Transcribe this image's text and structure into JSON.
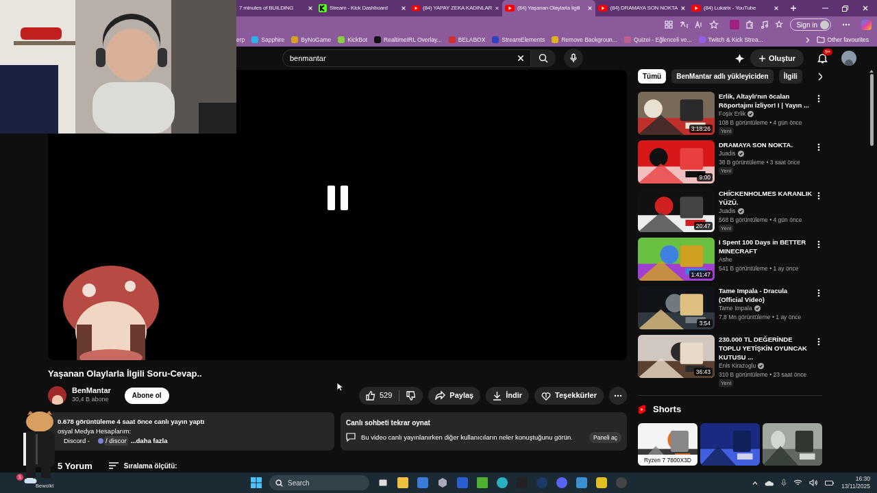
{
  "browser": {
    "tabs": [
      {
        "title": "7 minutes of BUILDING",
        "selected": false
      },
      {
        "title": "Stream - Kick Dashboard",
        "selected": false
      },
      {
        "title": "(84) YAPAY ZEKA KADINLAR",
        "selected": false
      },
      {
        "title": "(84) Yaşanan Olaylarla İlgili",
        "selected": true
      },
      {
        "title": "(84) DRAMAYA SON NOKTA",
        "selected": false
      },
      {
        "title": "(84) Lukarix - YouTube",
        "selected": false
      }
    ],
    "sign_in": "Sign in",
    "bookmarks": [
      "erp",
      "Sapphire",
      "ByNoGame",
      "KickBot",
      "RealtimeIRL Overlay...",
      "BELABOX",
      "StreamElements",
      "Remove Backgroun...",
      "Quizei - Eğlenceli ve...",
      "Twitch & Kick Strea..."
    ],
    "other_favourites": "Other favourites"
  },
  "header": {
    "search": {
      "value": "benmantar"
    },
    "create": "Oluştur",
    "notifications": "9+"
  },
  "video": {
    "title": "Yaşanan Olaylarla İlgili Soru-Cevap..",
    "channel": "BenMantar",
    "subscribers": "30,4 B abone",
    "subscribe": "Abone ol",
    "likes": "529",
    "actions": [
      {
        "kind": "share",
        "label": "Paylaş"
      },
      {
        "kind": "download",
        "label": "İndir"
      },
      {
        "kind": "thanks",
        "label": "Teşekkürler"
      }
    ]
  },
  "description": {
    "line_1": "0.678 görüntüleme  4 saat önce canlı yayın yaptı",
    "line_2": "osyal Medya Hesaplarım:",
    "discord": "Discord -",
    "link": "/ discor",
    "more": "...daha fazla"
  },
  "chat_replay": {
    "title": "Canlı sohbeti tekrar oynat",
    "text": "Bu video canlı yayınlanırken diğer kullanıcıların neler konuştuğunu görün.",
    "button": "Paneli aç"
  },
  "comments": {
    "count": "5 Yorum",
    "sort": "Sıralama ölçütü:"
  },
  "chips": [
    {
      "label": "Tümü",
      "selected": true
    },
    {
      "label": "BenMantar adlı yükleyiciden",
      "selected": false
    },
    {
      "label": "İlgili",
      "selected": false
    }
  ],
  "recommended": [
    {
      "title": "Erlik, Altaylı'nın öcalan Röportajını İzliyor! I | Yayın ...",
      "channel": "Foşix Erlik",
      "verified": true,
      "meta": "108 B görüntüleme • 4 gün önce",
      "duration": "3:18:26",
      "badge": "Yeni"
    },
    {
      "title": "DRAMAYA SON NOKTA.",
      "channel": "Juadis",
      "verified": true,
      "meta": "38 B görüntüleme • 3 saat önce",
      "duration": "9:00",
      "badge": "Yeni"
    },
    {
      "title": "CHİCKENHOLMES KARANLIK YÜZÜ.",
      "channel": "Juadis",
      "verified": true,
      "meta": "568 B görüntüleme • 4 gün önce",
      "duration": "20:47",
      "badge": "Yeni"
    },
    {
      "title": "I Spent 100 Days in BETTER MINECRAFT",
      "channel": "Ashe",
      "verified": false,
      "meta": "541 B görüntüleme • 1 ay önce",
      "duration": "1:41:47"
    },
    {
      "title": "Tame Impala - Dracula (Official Video)",
      "channel": "Tame Impala",
      "verified": true,
      "meta": "7,8 Mn görüntüleme • 1 ay önce",
      "duration": "3:54"
    },
    {
      "title": "230.000 TL DEĞERİNDE TOPLU YETİŞKİN OYUNCAK KUTUSU ...",
      "channel": "Enis Kirazoglu",
      "verified": true,
      "meta": "310 B görüntüleme • 23 saat önce",
      "duration": "36:43",
      "badge": "Yeni"
    }
  ],
  "shorts": {
    "title": "Shorts",
    "items": [
      {
        "kind": "captioned",
        "caption": "Ryzen 7 7800X3D"
      },
      {
        "kind": "picture"
      },
      {
        "kind": "picture"
      }
    ]
  },
  "taskbar": {
    "weather": "Bewolkt",
    "weather_badge": "1",
    "search": "Search",
    "time": "16:30",
    "date": "13/11/2025"
  }
}
